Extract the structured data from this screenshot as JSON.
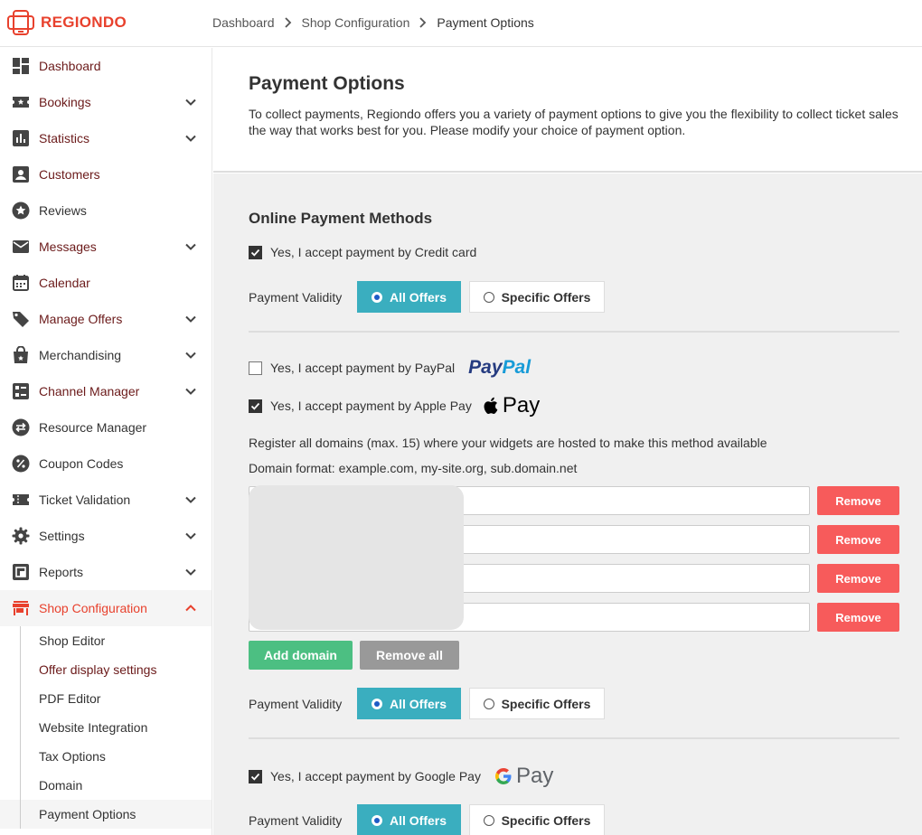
{
  "app": {
    "logo_text": "REGIONDO"
  },
  "breadcrumb": [
    "Dashboard",
    "Shop Configuration",
    "Payment Options"
  ],
  "sidebar": {
    "items": [
      {
        "label": "Dashboard",
        "icon": "dashboard-icon",
        "style": "link",
        "chevron": false
      },
      {
        "label": "Bookings",
        "icon": "ticket-star-icon",
        "style": "link",
        "chevron": true
      },
      {
        "label": "Statistics",
        "icon": "bar-chart-icon",
        "style": "link",
        "chevron": true
      },
      {
        "label": "Customers",
        "icon": "person-icon",
        "style": "link",
        "chevron": false
      },
      {
        "label": "Reviews",
        "icon": "star-icon",
        "style": "plain",
        "chevron": false
      },
      {
        "label": "Messages",
        "icon": "mail-icon",
        "style": "link",
        "chevron": true
      },
      {
        "label": "Calendar",
        "icon": "calendar-icon",
        "style": "link",
        "chevron": false
      },
      {
        "label": "Manage Offers",
        "icon": "tag-icon",
        "style": "link",
        "chevron": true
      },
      {
        "label": "Merchandising",
        "icon": "shopping-bag-icon",
        "style": "plain",
        "chevron": true
      },
      {
        "label": "Channel Manager",
        "icon": "channels-icon",
        "style": "link",
        "chevron": true
      },
      {
        "label": "Resource Manager",
        "icon": "swap-icon",
        "style": "plain",
        "chevron": false
      },
      {
        "label": "Coupon Codes",
        "icon": "percent-icon",
        "style": "plain",
        "chevron": false
      },
      {
        "label": "Ticket Validation",
        "icon": "ticket-icon",
        "style": "plain",
        "chevron": true
      },
      {
        "label": "Settings",
        "icon": "gear-icon",
        "style": "plain",
        "chevron": true
      },
      {
        "label": "Reports",
        "icon": "report-icon",
        "style": "plain",
        "chevron": true
      },
      {
        "label": "Shop Configuration",
        "icon": "store-icon",
        "style": "active",
        "chevron": true
      }
    ],
    "sub_items": [
      {
        "label": "Shop Editor",
        "style": "plain"
      },
      {
        "label": "Offer display settings",
        "style": "link"
      },
      {
        "label": "PDF Editor",
        "style": "plain"
      },
      {
        "label": "Website Integration",
        "style": "plain"
      },
      {
        "label": "Tax Options",
        "style": "plain"
      },
      {
        "label": "Domain",
        "style": "plain"
      },
      {
        "label": "Payment Options",
        "style": "active"
      }
    ]
  },
  "header": {
    "title": "Payment Options",
    "description": "To collect payments, Regiondo offers you a variety of payment options to give you the flexibility to collect ticket sales the way that works best for you. Please modify your choice of payment option."
  },
  "online": {
    "title": "Online Payment Methods",
    "credit_card": {
      "label": "Yes, I accept payment by Credit card",
      "checked": true
    },
    "validity_label": "Payment Validity",
    "all_offers": "All Offers",
    "specific_offers": "Specific Offers",
    "paypal": {
      "label": "Yes, I accept payment by PayPal",
      "checked": false,
      "logo_a": "Pay",
      "logo_b": "Pal"
    },
    "apple_pay": {
      "label": "Yes, I accept payment by Apple Pay",
      "checked": true,
      "logo_text": "Pay"
    },
    "domains_info": "Register all domains (max. 15) where your widgets are hosted to make this method available",
    "domain_format": "Domain format: example.com, my-site.org, sub.domain.net",
    "remove_label": "Remove",
    "add_domain": "Add domain",
    "remove_all": "Remove all",
    "google_pay": {
      "label": "Yes, I accept payment by Google Pay",
      "checked": true,
      "logo_text": "Pay"
    }
  },
  "colors": {
    "brand": "#e8412d",
    "all_offers_bg": "#3aaebf",
    "remove_bg": "#f75b5b",
    "add_bg": "#4cbf82",
    "remove_all_bg": "#999999"
  }
}
